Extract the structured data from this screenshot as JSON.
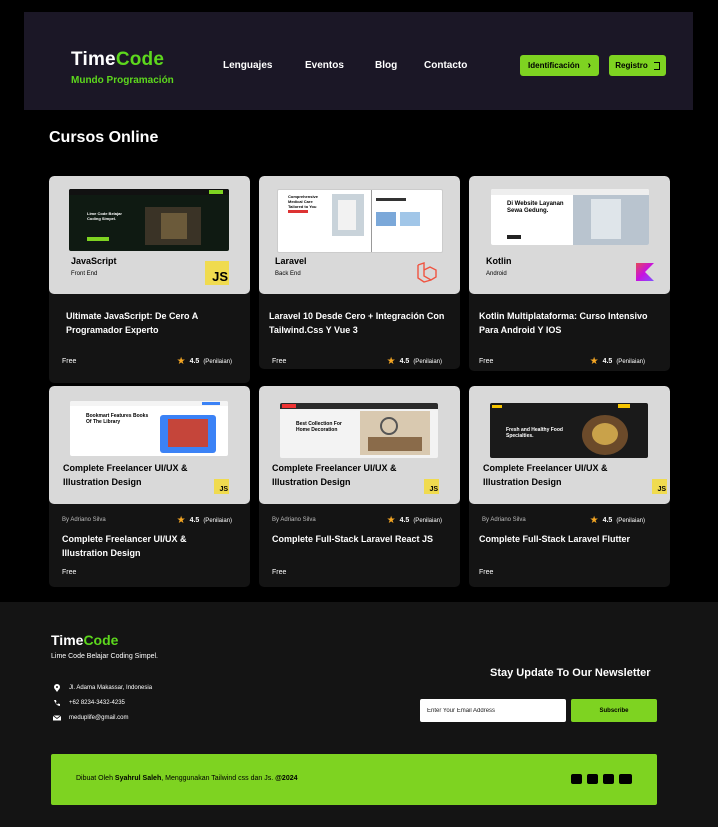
{
  "header": {
    "brand_part1": "Time",
    "brand_part2": "Code",
    "tagline": "Mundo Programación",
    "menu": [
      "Lenguajes",
      "Eventos",
      "Blog",
      "Contacto"
    ],
    "login_label": "Identificación",
    "register_label": "Registro",
    "accent_color": "#7ed321"
  },
  "section_title": "Cursos Online",
  "courses": [
    {
      "lang": "JavaScript",
      "lang_sub": "Front End",
      "title": "Ultimate JavaScript: De Cero A Programador Experto",
      "price": "Free",
      "rating": "4.5",
      "rating_label": "(Penilaian)",
      "badge": "JS",
      "shot_text": "Lime Code Belajar Coding Simpel."
    },
    {
      "lang": "Laravel",
      "lang_sub": "Back End",
      "title": "Laravel 10 Desde Cero + Integración Con Tailwind.Css Y Vue 3",
      "price": "Free",
      "rating": "4.5",
      "rating_label": "(Penilaian)",
      "badge": "laravel-icon",
      "shot_text": "Comprehensive Medical Care Tailored to You"
    },
    {
      "lang": "Kotlin",
      "lang_sub": "Android",
      "title": "Kotlin Multiplataforma: Curso Intensivo Para Android Y IOS",
      "price": "Free",
      "rating": "4.5",
      "rating_label": "(Penilaian)",
      "badge": "kotlin-icon",
      "shot_text": "Di Website Layanan Sewa Gedung."
    }
  ],
  "bottom_courses": [
    {
      "overlay": "Complete Freelancer UI/UX & Illustration Design",
      "author": "By Adriano Silva",
      "rating": "4.5",
      "rating_label": "(Penilaian)",
      "title": "Complete Freelancer UI/UX & Illustration Design",
      "price": "Free",
      "badge": "JS",
      "shot_text": "Bookmart Features Books Of The Library"
    },
    {
      "overlay": "Complete Freelancer UI/UX & Illustration Design",
      "author": "By Adriano Silva",
      "rating": "4.5",
      "rating_label": "(Penilaian)",
      "title": "Complete Full-Stack Laravel React JS",
      "price": "Free",
      "badge": "JS",
      "shot_text": "Best Collection For Home Decoration"
    },
    {
      "overlay": "Complete Freelancer UI/UX & Illustration Design",
      "author": "By Adriano Silva",
      "rating": "4.5",
      "rating_label": "(Penilaian)",
      "title": "Complete Full-Stack Laravel Flutter",
      "price": "Free",
      "badge": "JS",
      "shot_text": "Fresh and Healthy Food Specialties."
    }
  ],
  "footer": {
    "brand_part1": "Time",
    "brand_part2": "Code",
    "tagline": "Lime Code Belajar Coding Simpel.",
    "address": "Jl. Adama Makassar, Indonesia",
    "phone": "+62 8234-3432-4235",
    "email": "meduplife@gmail.com",
    "newsletter_title": "Stay Update To Our Newsletter",
    "email_placeholder": "Enter Your Email Address",
    "subscribe_label": "Subscribe",
    "credit_prefix": "Dibuat Oleh ",
    "credit_name": "Syahrul Saleh",
    "credit_suffix": ", Menggunakan Tailwind css dan Js. ",
    "credit_year": "@2024"
  }
}
